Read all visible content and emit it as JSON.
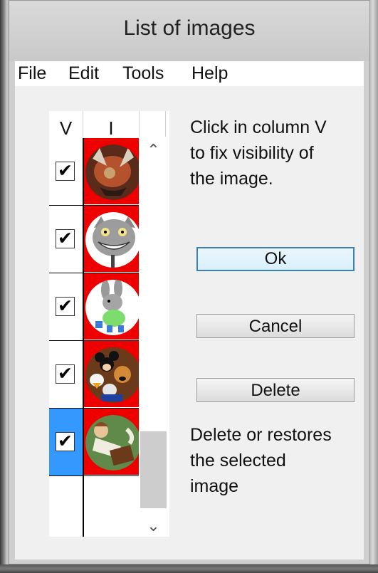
{
  "window": {
    "title": "List of images"
  },
  "menu": [
    "File",
    "Edit",
    "Tools",
    "Help"
  ],
  "grid": {
    "columns": [
      "V",
      "I"
    ],
    "rows": [
      {
        "checked": "✔",
        "image": "dragon-image",
        "selected": false
      },
      {
        "checked": "✔",
        "image": "cheshire-cat-image",
        "selected": false
      },
      {
        "checked": "✔",
        "image": "donkey-cartoon-image",
        "selected": false
      },
      {
        "checked": "✔",
        "image": "disney-characters-image",
        "selected": false
      },
      {
        "checked": "✔",
        "image": "boy-with-book-image",
        "selected": true
      }
    ],
    "scroll_up_icon": "chevron-up-icon",
    "scroll_down_icon": "chevron-down-icon"
  },
  "help_top": [
    "Click in column V",
    "to fix visibility of",
    "the image."
  ],
  "buttons": {
    "ok": "Ok",
    "cancel": "Cancel",
    "delete": "Delete"
  },
  "help_bottom": [
    "Delete or restores",
    "the selected",
    "image"
  ],
  "colors": {
    "selection": "#3399ff",
    "image_bg": "#ee0000",
    "default_button_border": "#3c7fb1"
  }
}
